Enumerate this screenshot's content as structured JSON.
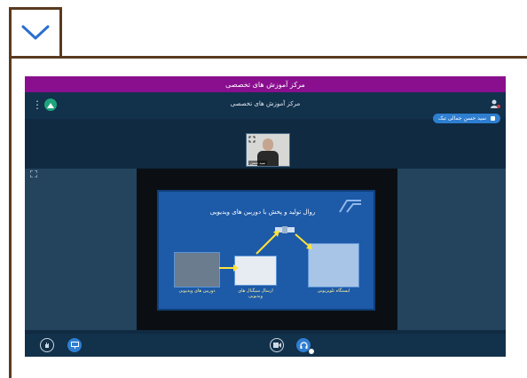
{
  "app": {
    "title_bar": "مرکز آموزش های تخصصی",
    "header_title": "مرکز آموزش های تخصصی",
    "presenter_name": "سید حسن جمالی تبک"
  },
  "webcam": {
    "name": "سید حسن"
  },
  "slide": {
    "title": "روال تولید و پخش با دوربین های ویدیویی",
    "captions": {
      "cameras": "دوربین های ویدیویی",
      "transmit": "ارسال سیگنال های ویدیویی",
      "station": "ایستگاه تلویزیونی"
    }
  },
  "colors": {
    "title_bar": "#8a0f8f",
    "app_bg": "#0f2a41",
    "pill": "#2e7ed1",
    "frame": "#5a3a1f"
  }
}
